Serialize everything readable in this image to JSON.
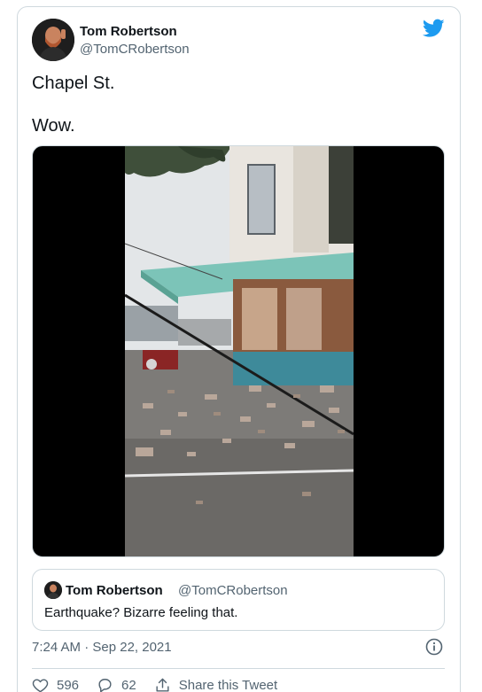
{
  "author": {
    "name": "Tom Robertson",
    "handle": "@TomCRobertson"
  },
  "tweet": {
    "text": "Chapel St.\n\nWow."
  },
  "quoted": {
    "name": "Tom Robertson",
    "handle": "@TomCRobertson",
    "text": "Earthquake? Bizarre feeling that."
  },
  "meta": {
    "timestamp": "7:24 AM · Sep 22, 2021"
  },
  "actions": {
    "likes": "596",
    "replies": "62",
    "share_label": "Share this Tweet"
  },
  "colors": {
    "brand": "#1d9bf0",
    "secondary_text": "#536471",
    "border": "#cfd9de"
  },
  "icons": [
    "twitter-logo-icon",
    "info-icon",
    "heart-icon",
    "reply-icon",
    "share-icon"
  ]
}
